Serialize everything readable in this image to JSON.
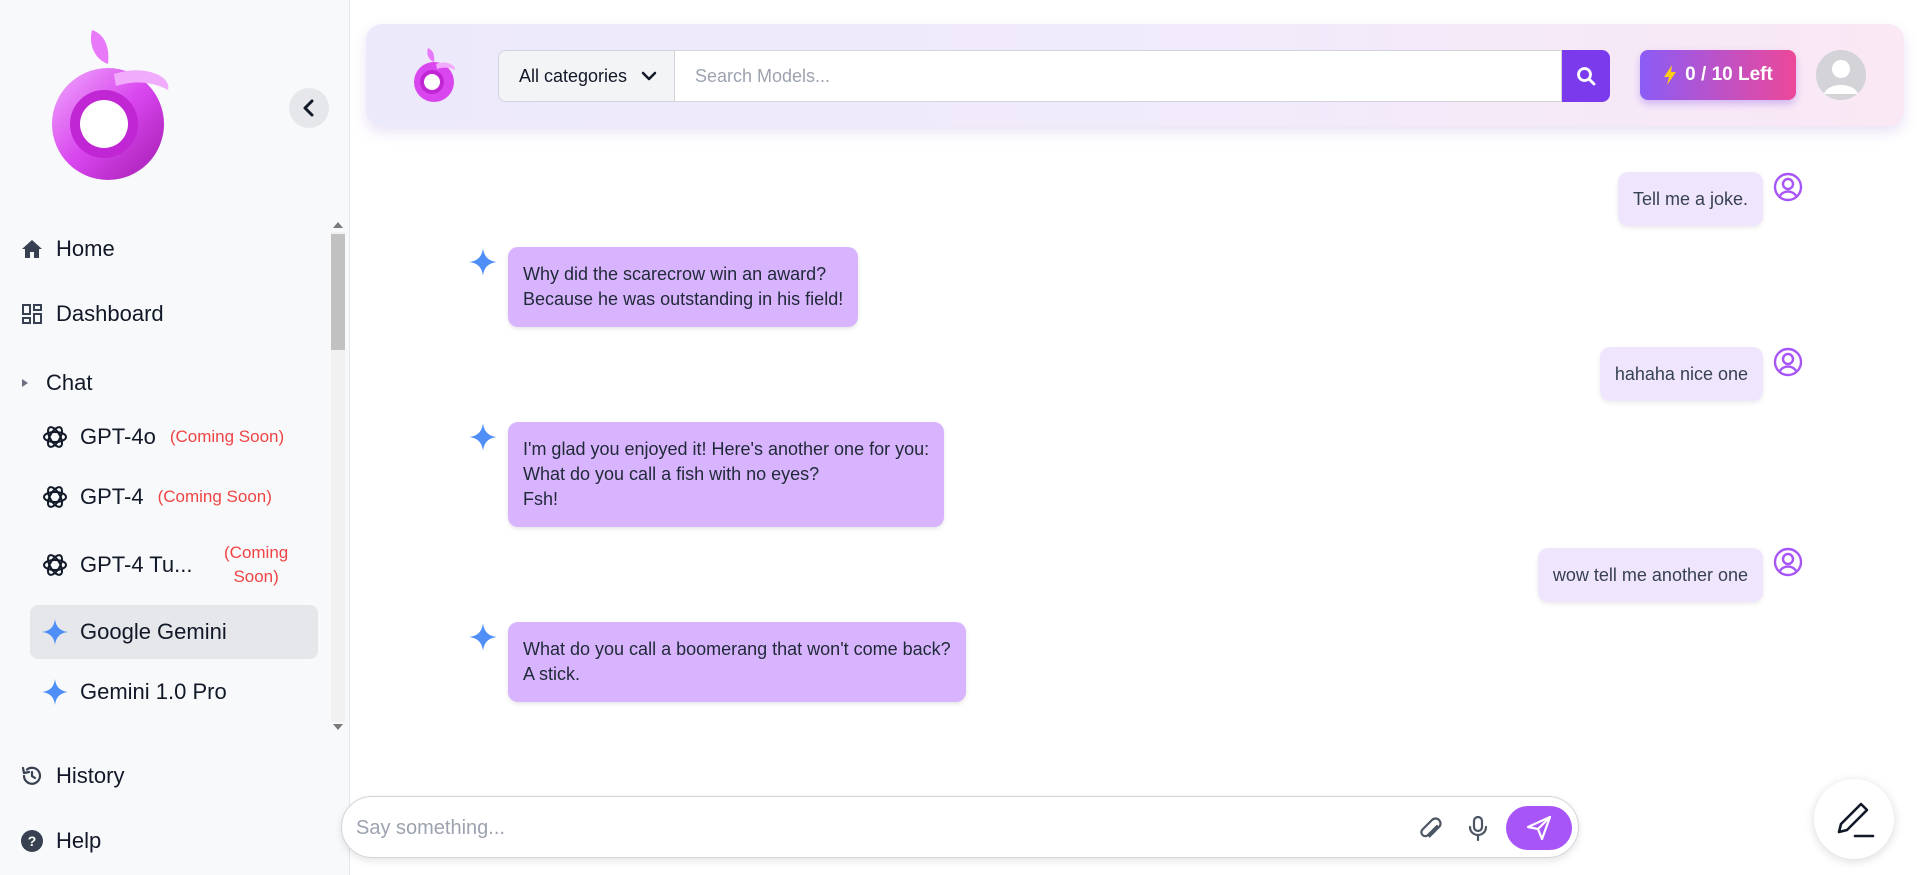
{
  "sidebar": {
    "nav": {
      "home": "Home",
      "dashboard": "Dashboard",
      "history": "History",
      "help": "Help"
    },
    "chat_section": "Chat",
    "models": [
      {
        "name": "GPT-4o",
        "badge": "(Coming Soon)",
        "icon": "openai-icon"
      },
      {
        "name": "GPT-4",
        "badge": "(Coming Soon)",
        "icon": "openai-icon"
      },
      {
        "name": "GPT-4 Tu...",
        "badge_line1": "(Coming",
        "badge_line2": "Soon)",
        "icon": "openai-icon"
      },
      {
        "name": "Google Gemini",
        "icon": "gemini-sparkle-icon",
        "active": true
      },
      {
        "name": "Gemini 1.0 Pro",
        "icon": "gemini-sparkle-icon"
      }
    ]
  },
  "topbar": {
    "category": "All categories",
    "search_placeholder": "Search Models...",
    "credits": "0 / 10 Left"
  },
  "messages": [
    {
      "role": "user",
      "lines": [
        "Tell me a joke."
      ]
    },
    {
      "role": "ai",
      "lines": [
        "Why did the scarecrow win an award?",
        "Because he was outstanding in his field!"
      ]
    },
    {
      "role": "user",
      "lines": [
        "hahaha nice one"
      ]
    },
    {
      "role": "ai",
      "lines": [
        "I'm glad you enjoyed it! Here's another one for you:",
        "What do you call a fish with no eyes?",
        "Fsh!"
      ]
    },
    {
      "role": "user",
      "lines": [
        "wow tell me another one"
      ]
    },
    {
      "role": "ai",
      "lines": [
        "What do you call a boomerang that won't come back?",
        "A stick."
      ]
    }
  ],
  "composer": {
    "placeholder": "Say something..."
  },
  "colors": {
    "accent": "#7c3aed",
    "ai_bubble": "#d8b4fe",
    "user_bubble": "#efe6fd",
    "coming_soon": "#ef4444"
  }
}
